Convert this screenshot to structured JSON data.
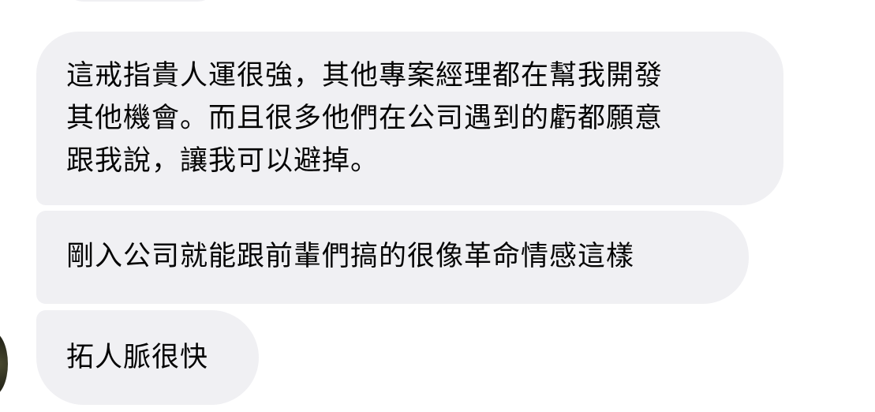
{
  "messages": [
    {
      "lines": [
        "這戒指貴人運很強，其他專案經理都在幫我開發",
        "其他機會。而且很多他們在公司遇到的虧都願意",
        "跟我說，讓我可以避掉。"
      ]
    },
    {
      "lines": [
        "剛入公司就能跟前輩們搞的很像革命情感這樣"
      ]
    },
    {
      "lines": [
        "拓人脈很快"
      ]
    }
  ],
  "colors": {
    "bubble_background": "#f0f0f3",
    "text": "#050505",
    "page_background": "#ffffff"
  }
}
